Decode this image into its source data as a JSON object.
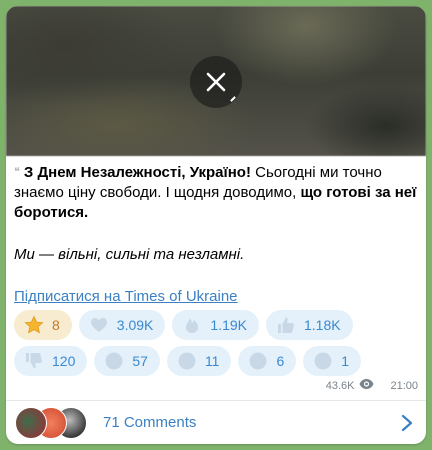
{
  "post": {
    "text_lead_bold": "З Днем Незалежності, Україно!",
    "text_lead_rest": " Сьогодні ми точно знаємо ціну свободи. І щодня доводимо, ",
    "text_lead_end_bold": "що готові за неї боротися.",
    "text_italic": "Ми — вільні, сильні та незламні.",
    "subscribe_link": "Підписатися на Times of Ukraine"
  },
  "reactions": [
    {
      "icon": "star-icon",
      "count": "8"
    },
    {
      "icon": "heart-icon",
      "count": "3.09K"
    },
    {
      "icon": "fire-icon",
      "count": "1.19K"
    },
    {
      "icon": "thumbs-up-icon",
      "count": "1.18K"
    },
    {
      "icon": "thumbs-down-icon",
      "count": "120"
    },
    {
      "icon": "reaction-icon",
      "count": "57"
    },
    {
      "icon": "reaction-icon",
      "count": "11"
    },
    {
      "icon": "reaction-icon",
      "count": "6"
    },
    {
      "icon": "reaction-icon",
      "count": "1"
    }
  ],
  "meta": {
    "views": "43.6K",
    "time": "21:00"
  },
  "comments": {
    "label": "71 Comments"
  },
  "colors": {
    "accent": "#3b80c4",
    "reaction_bg": "#e5f1fa",
    "star_reaction_bg": "#f7ebd0",
    "chat_background": "#7fb26a"
  }
}
